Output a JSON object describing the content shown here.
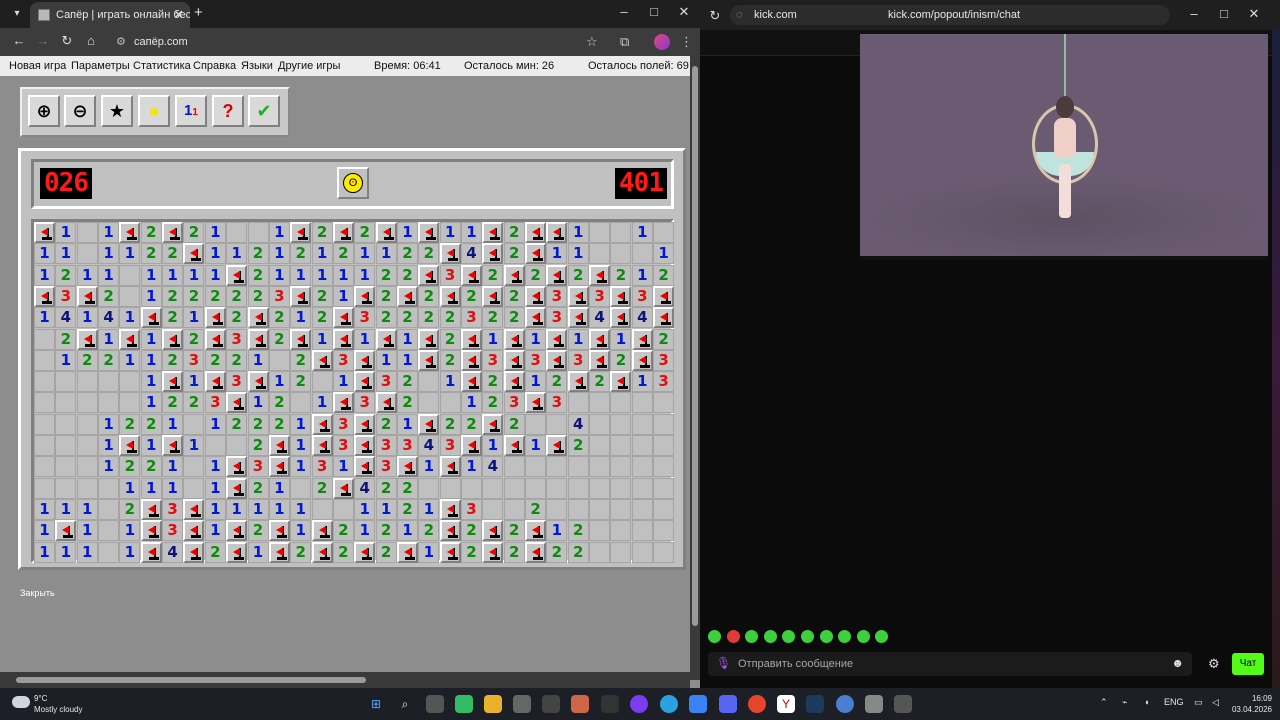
{
  "left_browser": {
    "tab_title": "Сапёр | играть онлайн беспла",
    "address": "сапёр.com",
    "menu": {
      "items": [
        "Новая игра",
        "Параметры",
        "Статистика",
        "Справка",
        "Языки",
        "Другие игры"
      ],
      "time": "Время: 06:41",
      "mines_left": "Осталось мин: 26",
      "fields_left": "Осталось полей: 69"
    },
    "tools": [
      "zoom-in",
      "zoom-out",
      "favorite",
      "hint",
      "settings-numbers",
      "help",
      "check"
    ],
    "counter_left": "026",
    "counter_right": "401",
    "close_label": "Закрыть"
  },
  "board": [
    "F1.1F2F21..1F2F2F1F11F2FF1..1..",
    "11.1122F11212121122F4F2F11...1..",
    "1211.1111F21111122F3F2F2F2F212..",
    "F3F2.1222223F21F2F2F2F2F3F3F3F3.",
    "14141F21F2F212F32222322F3F4F4F3.",
    ".2F1F1F2F3F2F1F1F1F2F1F1F1F1F23F1",
    ".1221123221.2F3F11F2F3F3F3F2F3F1",
    ".....1F1F3F12.1F32.1F2F12F2F13..",
    ".....1223F12.1F3F2..123F3......",
    "...1221.12221F3F21F22F2..4....",
    "...1F1F1..2F1F3F3343F1F1F2......",
    "...1221.1F3F131F3F1F14...........",
    "....111.1F21.2F422.............",
    "111.2F3F11111..1121F3..2.......",
    "1F1.1F3F1F2F1F21212F2F2F12.....",
    "111.1F4F2F1F2F2F2F1F2F2F22....."
  ],
  "right_browser": {
    "address_short": "kick.com",
    "address_full": "kick.com/popout/inism/chat",
    "chat_placeholder": "Отправить сообщение",
    "chat_button": "Чат"
  },
  "taskbar": {
    "temp": "9°C",
    "weather": "Mostly cloudy",
    "lang": "ENG",
    "time": "16:09",
    "date": "03.04.2026"
  }
}
